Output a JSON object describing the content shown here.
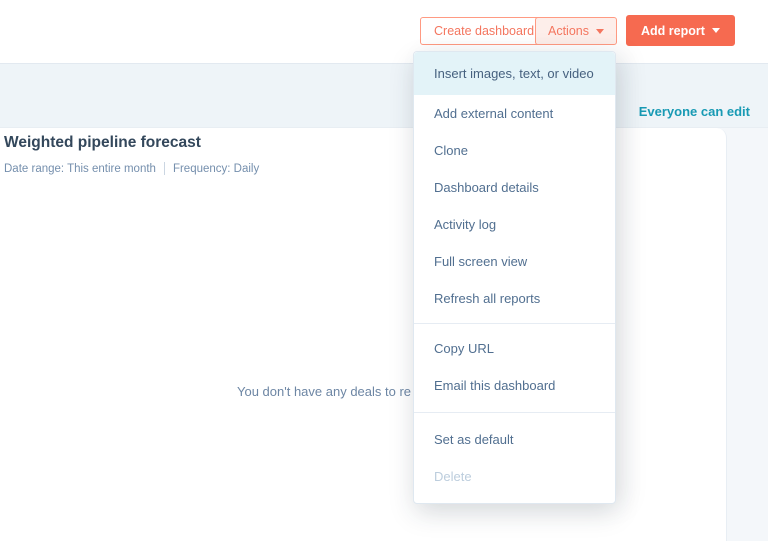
{
  "colors": {
    "accent_orange": "#f66a50",
    "accent_orange_border": "#ff9a82",
    "accent_orange_tint": "#fdeeea",
    "teal_link": "#189ab4",
    "heading_slate": "#33475b",
    "menu_text": "#516f90",
    "menu_highlight": "#e3f3f8",
    "band_background": "#eef4f8",
    "page_background": "#f4f7fa"
  },
  "toolbar": {
    "create_dashboard_label": "Create dashboard",
    "actions_label": "Actions",
    "add_report_label": "Add report"
  },
  "header_band": {
    "permission_label": "Everyone can edit"
  },
  "report": {
    "title": "Weighted pipeline forecast",
    "date_range_label": "Date range: This entire month",
    "frequency_label": "Frequency: Daily",
    "empty_message": "You don't have any deals to re"
  },
  "actions_menu": {
    "groups": [
      {
        "items": [
          {
            "label": "Insert images, text, or video",
            "highlighted": true,
            "disabled": false
          },
          {
            "label": "Add external content",
            "highlighted": false,
            "disabled": false
          },
          {
            "label": "Clone",
            "highlighted": false,
            "disabled": false
          },
          {
            "label": "Dashboard details",
            "highlighted": false,
            "disabled": false
          },
          {
            "label": "Activity log",
            "highlighted": false,
            "disabled": false
          },
          {
            "label": "Full screen view",
            "highlighted": false,
            "disabled": false
          },
          {
            "label": "Refresh all reports",
            "highlighted": false,
            "disabled": false
          }
        ]
      },
      {
        "items": [
          {
            "label": "Copy URL",
            "highlighted": false,
            "disabled": false
          },
          {
            "label": "Email this dashboard",
            "highlighted": false,
            "disabled": false
          }
        ]
      },
      {
        "items": [
          {
            "label": "Set as default",
            "highlighted": false,
            "disabled": false
          },
          {
            "label": "Delete",
            "highlighted": false,
            "disabled": true
          }
        ]
      }
    ]
  }
}
